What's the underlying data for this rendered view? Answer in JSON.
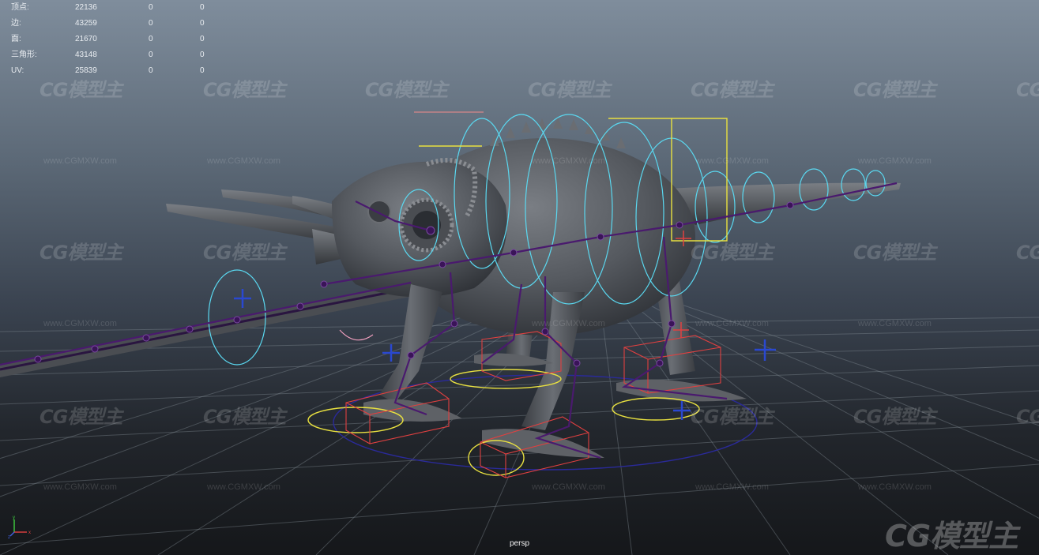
{
  "hud": {
    "rows": [
      {
        "label": "顶点:",
        "total": "22136",
        "selected": "0",
        "tri": "0"
      },
      {
        "label": "边:",
        "total": "43259",
        "selected": "0",
        "tri": "0"
      },
      {
        "label": "面:",
        "total": "21670",
        "selected": "0",
        "tri": "0"
      },
      {
        "label": "三角形:",
        "total": "43148",
        "selected": "0",
        "tri": "0"
      },
      {
        "label": "UV:",
        "total": "25839",
        "selected": "0",
        "tri": "0"
      }
    ]
  },
  "viewport": {
    "camera": "persp",
    "background_top": "#7f8d9c",
    "background_bottom": "#15171a",
    "model_color": "#5a5d62",
    "joint_color": "#4a1a6e",
    "ik_control_color": "#5ad8f0",
    "fk_control_color": "#e8e040",
    "foot_box_color": "#e04040",
    "world_ring_color": "#2a2a9a",
    "grid_color": "#8a929c"
  },
  "watermark": {
    "logo_text": "CG模型主",
    "url_text": "www.CGMXW.com"
  },
  "axis": {
    "x_label": "x",
    "y_label": "y",
    "z_label": "z"
  }
}
